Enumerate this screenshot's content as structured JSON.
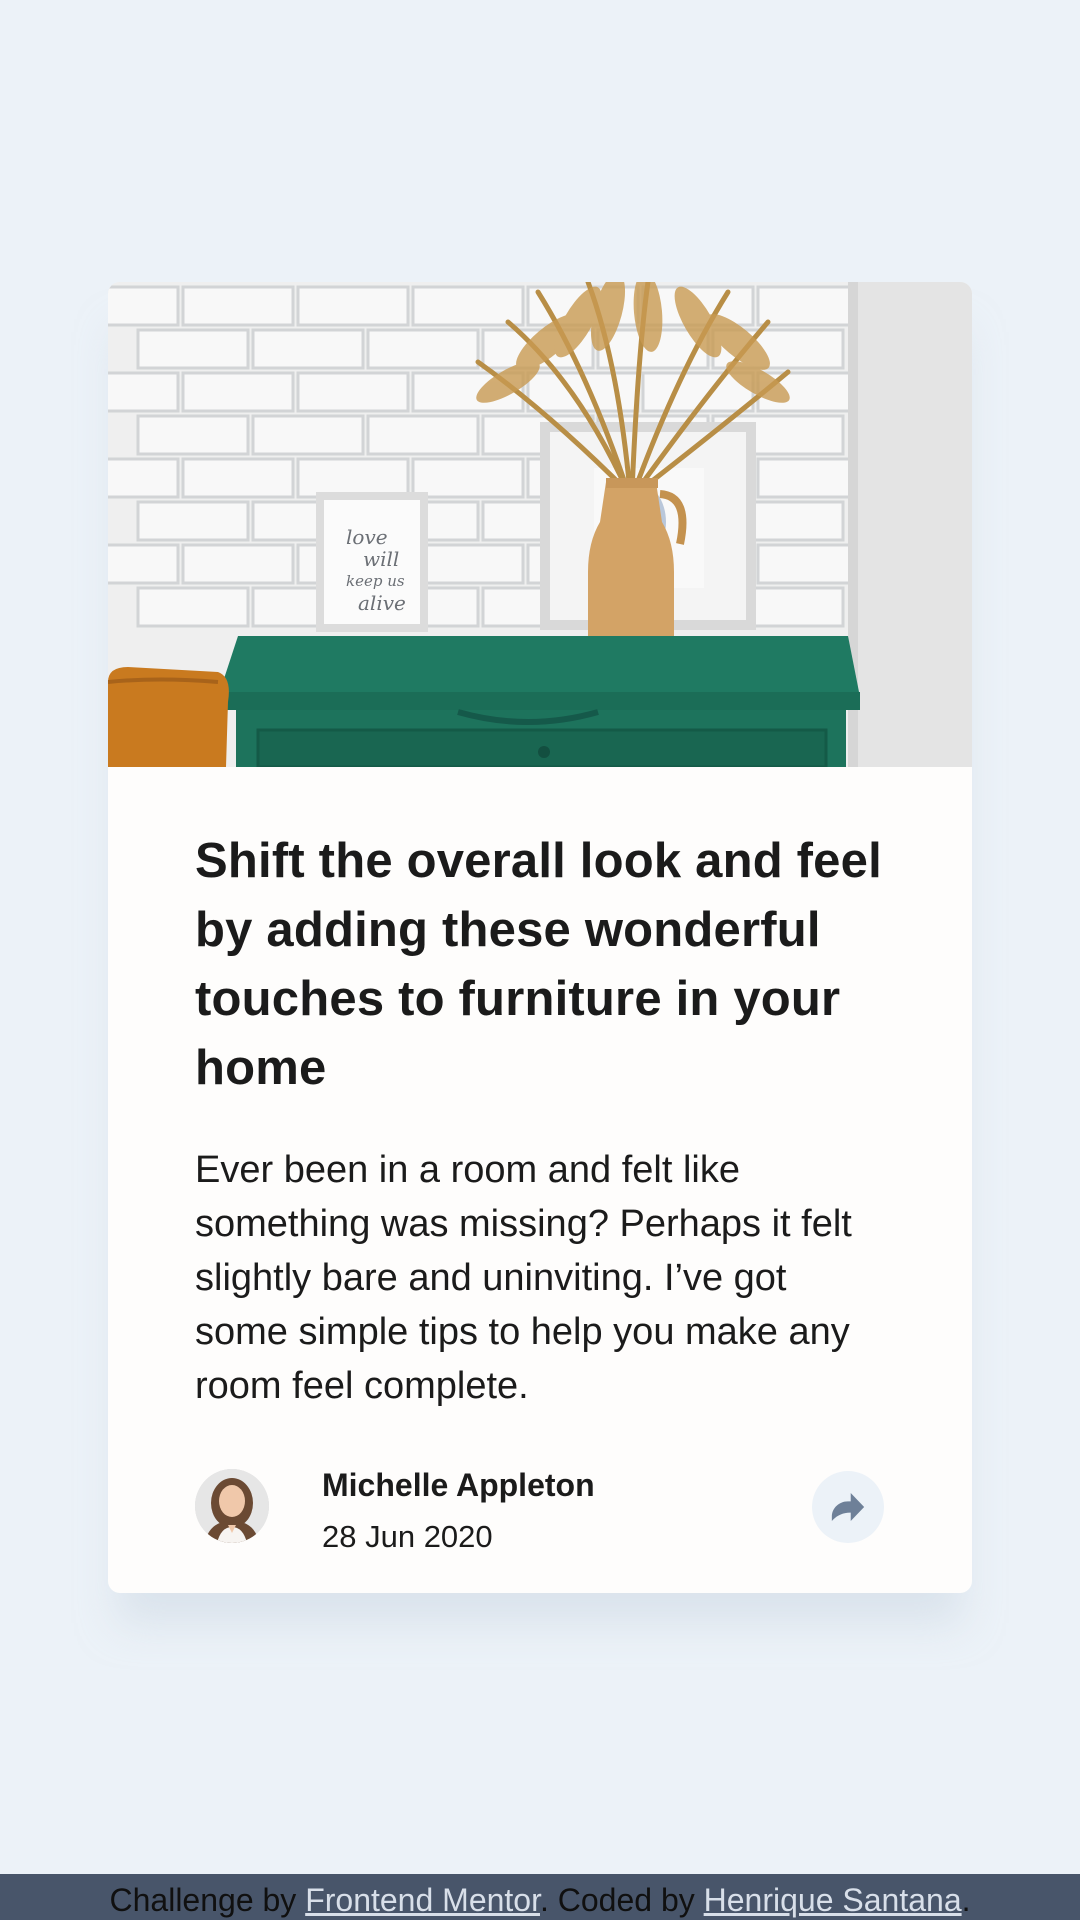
{
  "card": {
    "title": "Shift the overall look and feel by adding these wonderful touches to furniture in your home",
    "description": "Ever been in a room and felt like something was missing? Perhaps it felt slightly bare and uninviting. I’ve got some simple tips to help you make any room feel complete.",
    "author": {
      "name": "Michelle Appleton",
      "date": "28 Jun 2020"
    },
    "frame_text": "love will keep us alive"
  },
  "attribution": {
    "prefix": "Challenge by ",
    "link1": "Frontend Mentor",
    "middle": ". Coded by ",
    "link2": "Henrique Santana",
    "suffix": "."
  },
  "icons": {
    "share": "share-icon"
  },
  "colors": {
    "page_bg": "#ecf2f8",
    "card_bg": "#fefdfc",
    "text": "#1b1b1b",
    "share_bg": "#ecf2f8",
    "share_icon": "#6e8098",
    "footer_bg": "#48556a",
    "footer_link": "#d8dfe9"
  }
}
